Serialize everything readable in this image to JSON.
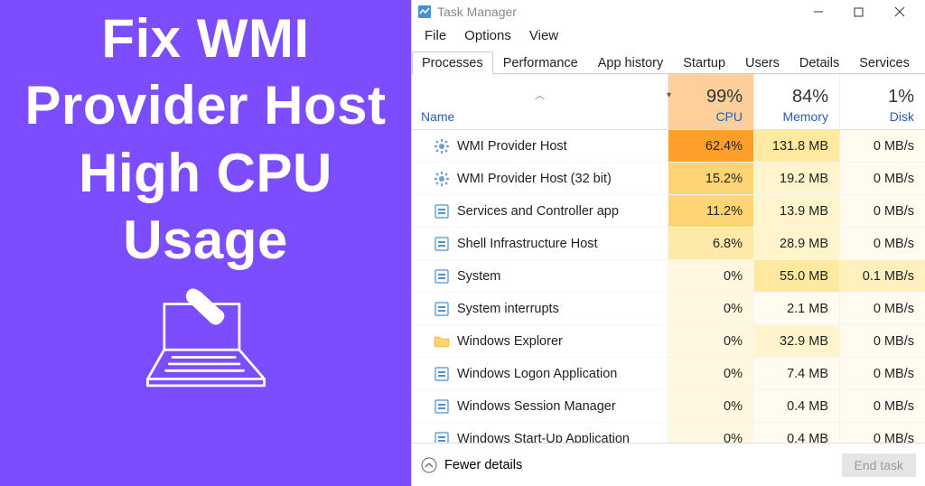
{
  "promo": {
    "headline": "Fix WMI Provider Host High CPU Usage"
  },
  "window": {
    "title": "Task Manager",
    "menus": [
      "File",
      "Options",
      "View"
    ],
    "tabs": [
      "Processes",
      "Performance",
      "App history",
      "Startup",
      "Users",
      "Details",
      "Services"
    ],
    "active_tab": "Processes"
  },
  "columns": {
    "name_label": "Name",
    "metrics": [
      {
        "key": "cpu",
        "label": "CPU",
        "pct": "99%"
      },
      {
        "key": "mem",
        "label": "Memory",
        "pct": "84%"
      },
      {
        "key": "disk",
        "label": "Disk",
        "pct": "1%"
      }
    ]
  },
  "processes": [
    {
      "name": "WMI Provider Host",
      "icon": "gear",
      "cpu": "62.4%",
      "cpu_h": 4,
      "mem": "131.8 MB",
      "mem_h": 2,
      "disk": "0 MB/s",
      "disk_h": 0
    },
    {
      "name": "WMI Provider Host (32 bit)",
      "icon": "gear",
      "cpu": "15.2%",
      "cpu_h": 2,
      "mem": "19.2 MB",
      "mem_h": 1,
      "disk": "0 MB/s",
      "disk_h": 0
    },
    {
      "name": "Services and Controller app",
      "icon": "app",
      "cpu": "11.2%",
      "cpu_h": 2,
      "mem": "13.9 MB",
      "mem_h": 1,
      "disk": "0 MB/s",
      "disk_h": 0
    },
    {
      "name": "Shell Infrastructure Host",
      "icon": "app",
      "cpu": "6.8%",
      "cpu_h": 1,
      "mem": "28.9 MB",
      "mem_h": 1,
      "disk": "0 MB/s",
      "disk_h": 0
    },
    {
      "name": "System",
      "icon": "app",
      "cpu": "0%",
      "cpu_h": 0,
      "mem": "55.0 MB",
      "mem_h": 2,
      "disk": "0.1 MB/s",
      "disk_h": 1
    },
    {
      "name": "System interrupts",
      "icon": "app",
      "cpu": "0%",
      "cpu_h": 0,
      "mem": "2.1 MB",
      "mem_h": 0,
      "disk": "0 MB/s",
      "disk_h": 0
    },
    {
      "name": "Windows Explorer",
      "icon": "folder",
      "cpu": "0%",
      "cpu_h": 0,
      "mem": "32.9 MB",
      "mem_h": 1,
      "disk": "0 MB/s",
      "disk_h": 0
    },
    {
      "name": "Windows Logon Application",
      "icon": "app",
      "cpu": "0%",
      "cpu_h": 0,
      "mem": "7.4 MB",
      "mem_h": 0,
      "disk": "0 MB/s",
      "disk_h": 0
    },
    {
      "name": "Windows Session Manager",
      "icon": "app",
      "cpu": "0%",
      "cpu_h": 0,
      "mem": "0.4 MB",
      "mem_h": 0,
      "disk": "0 MB/s",
      "disk_h": 0
    },
    {
      "name": "Windows Start-Up Application",
      "icon": "app",
      "cpu": "0%",
      "cpu_h": 0,
      "mem": "0.4 MB",
      "mem_h": 0,
      "disk": "0 MB/s",
      "disk_h": 0
    }
  ],
  "footer": {
    "toggle_label": "Fewer details",
    "end_task_label": "End task"
  }
}
